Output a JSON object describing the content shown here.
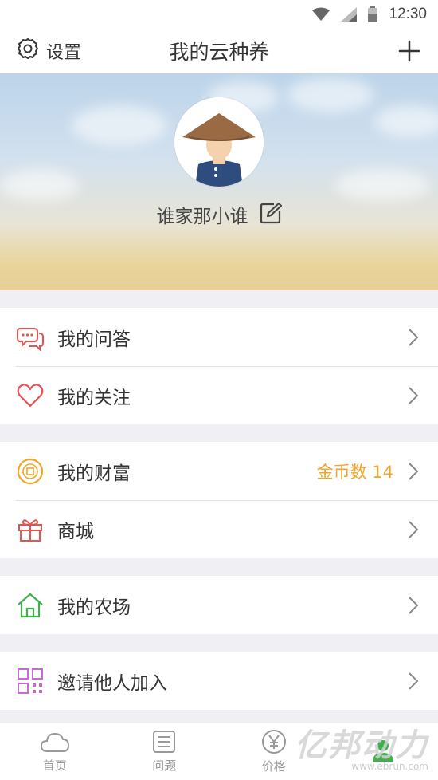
{
  "status_bar": {
    "time": "12:30"
  },
  "header": {
    "settings_label": "设置",
    "title": "我的云种养"
  },
  "profile": {
    "username": "谁家那小谁"
  },
  "groups": [
    {
      "items": [
        {
          "label": "我的问答",
          "icon": "chat-bubbles-icon"
        },
        {
          "label": "我的关注",
          "icon": "heart-icon"
        }
      ]
    },
    {
      "items": [
        {
          "label": "我的财富",
          "icon": "coin-icon",
          "extra": "金币数 14"
        },
        {
          "label": "商城",
          "icon": "gift-icon"
        }
      ]
    },
    {
      "items": [
        {
          "label": "我的农场",
          "icon": "home-icon"
        }
      ]
    },
    {
      "items": [
        {
          "label": "邀请他人加入",
          "icon": "qr-code-icon"
        }
      ]
    }
  ],
  "tabs": [
    {
      "label": "首页",
      "icon": "cloud-icon"
    },
    {
      "label": "问题",
      "icon": "list-icon"
    },
    {
      "label": "价格",
      "icon": "yen-icon"
    },
    {
      "label": "",
      "icon": "person-icon",
      "active": true
    }
  ],
  "watermark": {
    "text": "亿邦动力",
    "url": "www.ebrun.com"
  },
  "colors": {
    "accent_green": "#3fb04b",
    "coin_orange": "#f0a52b",
    "heart_red": "#e55353",
    "qr_purple": "#c869d6"
  }
}
